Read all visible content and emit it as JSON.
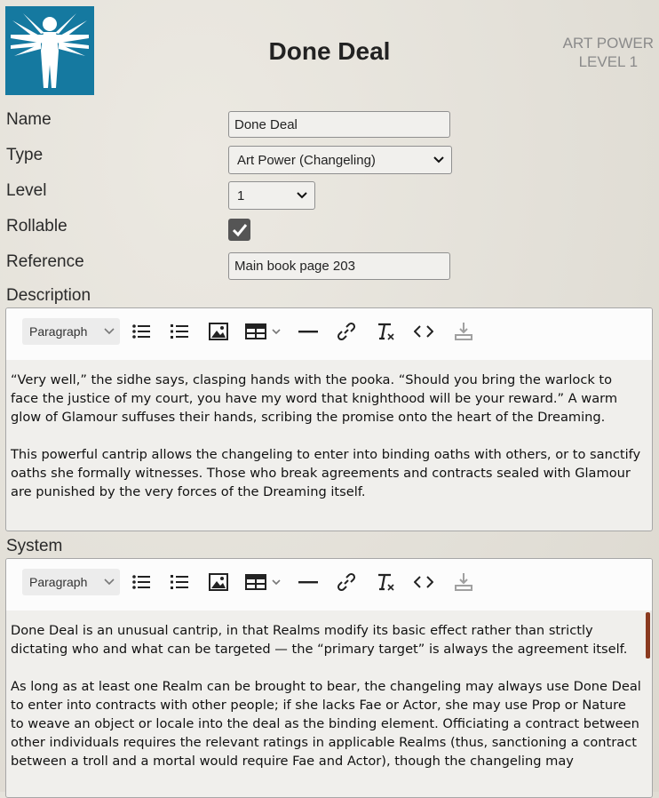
{
  "header": {
    "title": "Done Deal",
    "badge_line1": "ART POWER",
    "badge_line2": "LEVEL 1",
    "logo_icon": "changeling-figure-icon",
    "logo_color": "#1579a0"
  },
  "form": {
    "name_label": "Name",
    "name_value": "Done Deal",
    "type_label": "Type",
    "type_value": "Art Power (Changeling)",
    "level_label": "Level",
    "level_value": "1",
    "rollable_label": "Rollable",
    "rollable_checked": true,
    "reference_label": "Reference",
    "reference_value": "Main book page 203"
  },
  "description": {
    "label": "Description",
    "format_value": "Paragraph",
    "paragraphs": [
      "“Very well,” the sidhe says, clasping hands with the pooka. “Should you bring the warlock to face the justice of my court, you have my word that knighthood will be your reward.” A warm glow of Glamour suffuses their hands, scribing the promise onto the heart of the Dreaming.",
      "This powerful cantrip allows the changeling to enter into binding oaths with others, or to sanctify oaths she formally witnesses. Those who break agreements and contracts sealed with Glamour are punished by the very forces of the Dreaming itself."
    ]
  },
  "system": {
    "label": "System",
    "format_value": "Paragraph",
    "paragraphs": [
      "Done Deal is an unusual cantrip, in that Realms modify its basic effect rather than strictly dictating who and what can be targeted — the “primary target” is always the agreement itself.",
      "As long as at least one Realm can be brought to bear, the changeling may always use Done Deal to enter into contracts with other people; if she lacks Fae or Actor, she may use Prop or Nature to weave an object or locale into the deal as the binding element. Officiating a contract between other individuals requires the relevant ratings in applicable Realms (thus, sanctioning a contract between a troll and a mortal would require Fae and Actor), though the changeling may"
    ]
  },
  "toolbar_icons": [
    "bulleted-list-icon",
    "numbered-list-icon",
    "insert-image-icon",
    "insert-table-icon",
    "horizontal-line-icon",
    "link-icon",
    "remove-format-icon",
    "source-code-icon",
    "save-icon"
  ]
}
